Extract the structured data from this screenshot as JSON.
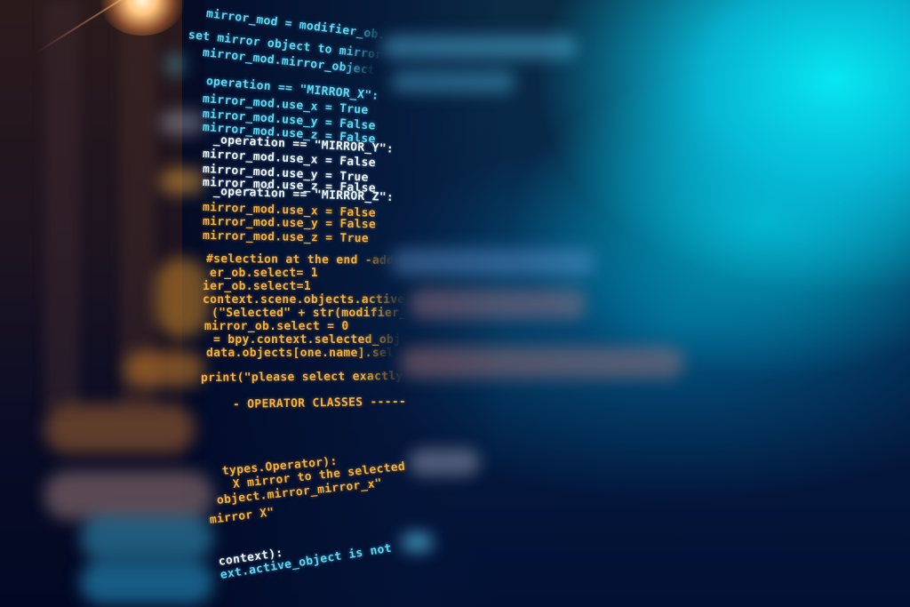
{
  "photo": {
    "subject": "programming source code on screen with bokeh",
    "colors": {
      "cyan_text": "#5fd9f2",
      "white_text": "#eef6fb",
      "amber_text": "#f7b23a",
      "background_dark": "#02081f",
      "background_cyan": "#08e6f2"
    }
  },
  "code_lines": [
    "mirror_mod = modifier_ob.",
    "set mirror object to mirror",
    "mirror_mod.mirror_object",
    "operation == \"MIRROR_X\":",
    "mirror_mod.use_x = True",
    "mirror_mod.use_y = False",
    "mirror_mod.use_z = False",
    "_operation == \"MIRROR_Y\":",
    "mirror_mod.use_x = False",
    "mirror_mod.use_y = True",
    "mirror_mod.use_z = False",
    "_operation == \"MIRROR_Z\":",
    "mirror_mod.use_x = False",
    "mirror_mod.use_y = False",
    "mirror_mod.use_z = True",
    "#selection at the end -add",
    "er_ob.select= 1",
    "ier_ob.select=1",
    "context.scene.objects.active",
    "(\"Selected\" + str(modifier_",
    "mirror_ob.select = 0",
    "= bpy.context.selected_obj",
    "data.objects[one.name].sel",
    "print(\"please select exactly",
    "- OPERATOR CLASSES -----",
    "types.Operator):",
    "X mirror to the selected",
    "object.mirror_mirror_x\"",
    "mirror X\"",
    "context):",
    "ext.active_object is not"
  ]
}
